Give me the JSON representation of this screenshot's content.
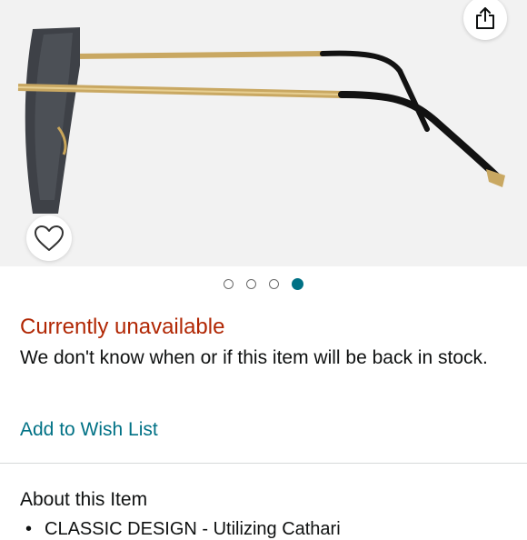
{
  "product": {
    "image_alt": "rimless sunglasses side view",
    "image_count": 4,
    "active_image_index": 3
  },
  "icons": {
    "share": "share-icon",
    "wishlist": "heart-outline-icon"
  },
  "availability": {
    "status": "Currently unavailable",
    "note": "We don't know when or if this item will be back in stock."
  },
  "actions": {
    "add_to_wish_list": "Add to Wish List"
  },
  "about": {
    "heading": "About this Item",
    "bullets": [
      "CLASSIC DESIGN - Utilizing Cathari"
    ]
  },
  "colors": {
    "unavailable": "#b12704",
    "link": "#007185",
    "text": "#0f1111"
  }
}
